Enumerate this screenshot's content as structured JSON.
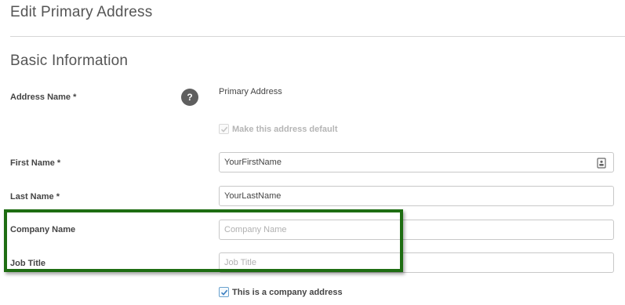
{
  "page": {
    "title": "Edit Primary Address"
  },
  "basic_info": {
    "section_title": "Basic Information",
    "address_name": {
      "label": "Address Name *",
      "help_icon_glyph": "?",
      "value": "Primary Address"
    },
    "default_checkbox": {
      "label": "Make this address default",
      "checked": true,
      "disabled": true
    },
    "first_name": {
      "label": "First Name *",
      "value": "YourFirstName",
      "icon": "contact-card-icon"
    },
    "last_name": {
      "label": "Last Name *",
      "value": "YourLastName"
    },
    "company_name": {
      "label": "Company Name",
      "value": "",
      "placeholder": "Company Name"
    },
    "job_title": {
      "label": "Job Title",
      "value": "",
      "placeholder": "Job Title"
    },
    "company_address_checkbox": {
      "label": "This is a company address",
      "checked": true
    }
  },
  "colors": {
    "highlight_border": "#1e6d12",
    "help_icon_bg": "#5f5f5f",
    "input_border": "#c8c8c8"
  }
}
